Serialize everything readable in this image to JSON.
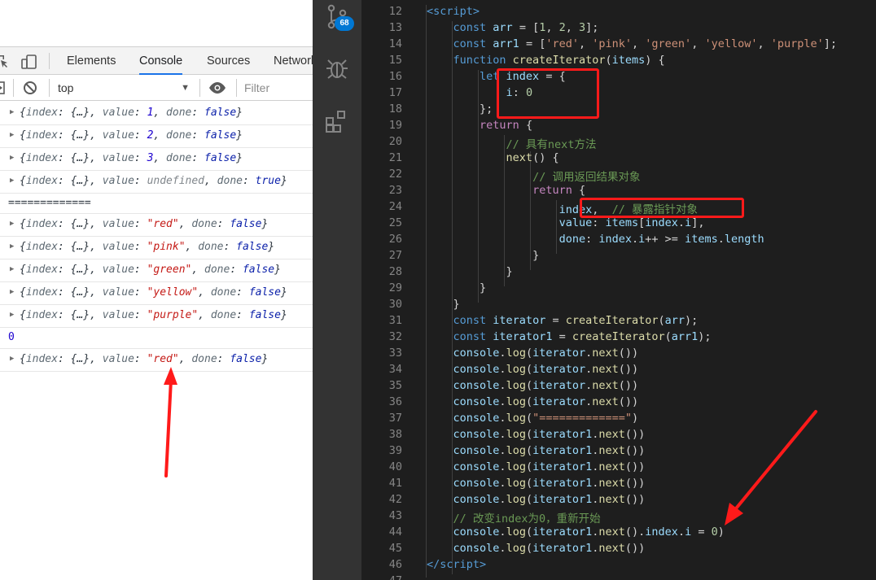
{
  "devtools": {
    "tabs": [
      "Elements",
      "Console",
      "Sources",
      "Network"
    ],
    "active_tab": "Console",
    "context": "top",
    "filter_placeholder": "Filter",
    "console_rows": [
      {
        "kind": "obj",
        "value": "1",
        "vtype": "num",
        "done": "false"
      },
      {
        "kind": "obj",
        "value": "2",
        "vtype": "num",
        "done": "false"
      },
      {
        "kind": "obj",
        "value": "3",
        "vtype": "num",
        "done": "false"
      },
      {
        "kind": "obj",
        "value": "undefined",
        "vtype": "undef",
        "done": "true"
      },
      {
        "kind": "plain",
        "text": "============="
      },
      {
        "kind": "obj",
        "value": "\"red\"",
        "vtype": "str",
        "done": "false"
      },
      {
        "kind": "obj",
        "value": "\"pink\"",
        "vtype": "str",
        "done": "false"
      },
      {
        "kind": "obj",
        "value": "\"green\"",
        "vtype": "str",
        "done": "false"
      },
      {
        "kind": "obj",
        "value": "\"yellow\"",
        "vtype": "str",
        "done": "false"
      },
      {
        "kind": "obj",
        "value": "\"purple\"",
        "vtype": "str",
        "done": "false"
      },
      {
        "kind": "num",
        "text": "0"
      },
      {
        "kind": "obj",
        "value": "\"red\"",
        "vtype": "str",
        "done": "false"
      }
    ]
  },
  "activity_bar": {
    "items": [
      "source-control-icon",
      "debug-icon",
      "extensions-icon"
    ],
    "scm_badge": "68"
  },
  "editor": {
    "lines": [
      {
        "n": "12",
        "t": [
          [
            "<",
            "tag"
          ],
          [
            "script",
            "tag"
          ],
          [
            ">",
            "tag"
          ]
        ]
      },
      {
        "n": "13",
        "t": [
          [
            "const ",
            "kw"
          ],
          [
            "arr",
            "var"
          ],
          [
            " = [",
            "p"
          ],
          [
            "1",
            "num"
          ],
          [
            ", ",
            "p"
          ],
          [
            "2",
            "num"
          ],
          [
            ", ",
            "p"
          ],
          [
            "3",
            "num"
          ],
          [
            "];",
            "p"
          ]
        ]
      },
      {
        "n": "14",
        "t": [
          [
            "const ",
            "kw"
          ],
          [
            "arr1",
            "var"
          ],
          [
            " = [",
            "p"
          ],
          [
            "'red'",
            "str"
          ],
          [
            ", ",
            "p"
          ],
          [
            "'pink'",
            "str"
          ],
          [
            ", ",
            "p"
          ],
          [
            "'green'",
            "str"
          ],
          [
            ", ",
            "p"
          ],
          [
            "'yellow'",
            "str"
          ],
          [
            ", ",
            "p"
          ],
          [
            "'purple'",
            "str"
          ],
          [
            "];",
            "p"
          ]
        ]
      },
      {
        "n": "15",
        "t": [
          [
            "function ",
            "kw"
          ],
          [
            "createIterator",
            "fn"
          ],
          [
            "(",
            "p"
          ],
          [
            "items",
            "var"
          ],
          [
            ") {",
            "p"
          ]
        ]
      },
      {
        "n": "16",
        "t": [
          [
            "let ",
            "kw"
          ],
          [
            "index",
            "var"
          ],
          [
            " = {",
            "p"
          ]
        ]
      },
      {
        "n": "17",
        "t": [
          [
            "i",
            "var"
          ],
          [
            ": ",
            "p"
          ],
          [
            "0",
            "num"
          ]
        ]
      },
      {
        "n": "18",
        "t": [
          [
            "};",
            "p"
          ]
        ]
      },
      {
        "n": "19",
        "t": [
          [
            "return",
            "ctl"
          ],
          [
            " {",
            "p"
          ]
        ]
      },
      {
        "n": "20",
        "t": [
          [
            "// 具有next方法",
            "cmt"
          ]
        ]
      },
      {
        "n": "21",
        "t": [
          [
            "next",
            "fn"
          ],
          [
            "() {",
            "p"
          ]
        ]
      },
      {
        "n": "22",
        "t": [
          [
            "// 调用返回结果对象",
            "cmt"
          ]
        ]
      },
      {
        "n": "23",
        "t": [
          [
            "return",
            "ctl"
          ],
          [
            " {",
            "p"
          ]
        ]
      },
      {
        "n": "24",
        "t": [
          [
            "index",
            "var"
          ],
          [
            ",  ",
            "p"
          ],
          [
            "// 暴露指针对象",
            "cmt"
          ]
        ]
      },
      {
        "n": "25",
        "t": [
          [
            "value",
            "var"
          ],
          [
            ": ",
            "p"
          ],
          [
            "items",
            "var"
          ],
          [
            "[",
            "p"
          ],
          [
            "index",
            "var"
          ],
          [
            ".",
            "p"
          ],
          [
            "i",
            "var"
          ],
          [
            "],",
            "p"
          ]
        ]
      },
      {
        "n": "26",
        "t": [
          [
            "done",
            "var"
          ],
          [
            ": ",
            "p"
          ],
          [
            "index",
            "var"
          ],
          [
            ".",
            "p"
          ],
          [
            "i",
            "var"
          ],
          [
            "++ >= ",
            "p"
          ],
          [
            "items",
            "var"
          ],
          [
            ".",
            "p"
          ],
          [
            "length",
            "var"
          ]
        ]
      },
      {
        "n": "27",
        "t": [
          [
            "}",
            "p"
          ]
        ]
      },
      {
        "n": "28",
        "t": [
          [
            "}",
            "p"
          ]
        ]
      },
      {
        "n": "29",
        "t": [
          [
            "}",
            "p"
          ]
        ]
      },
      {
        "n": "30",
        "t": [
          [
            "}",
            "p"
          ]
        ]
      },
      {
        "n": "31",
        "t": [
          [
            "const ",
            "kw"
          ],
          [
            "iterator",
            "var"
          ],
          [
            " = ",
            "p"
          ],
          [
            "createIterator",
            "fn"
          ],
          [
            "(",
            "p"
          ],
          [
            "arr",
            "var"
          ],
          [
            ");",
            "p"
          ]
        ]
      },
      {
        "n": "32",
        "t": [
          [
            "const ",
            "kw"
          ],
          [
            "iterator1",
            "var"
          ],
          [
            " = ",
            "p"
          ],
          [
            "createIterator",
            "fn"
          ],
          [
            "(",
            "p"
          ],
          [
            "arr1",
            "var"
          ],
          [
            ");",
            "p"
          ]
        ]
      },
      {
        "n": "33",
        "t": [
          [
            "console",
            "var"
          ],
          [
            ".",
            "p"
          ],
          [
            "log",
            "fn"
          ],
          [
            "(",
            "p"
          ],
          [
            "iterator",
            "var"
          ],
          [
            ".",
            "p"
          ],
          [
            "next",
            "fn"
          ],
          [
            "())",
            "p"
          ]
        ]
      },
      {
        "n": "34",
        "t": [
          [
            "console",
            "var"
          ],
          [
            ".",
            "p"
          ],
          [
            "log",
            "fn"
          ],
          [
            "(",
            "p"
          ],
          [
            "iterator",
            "var"
          ],
          [
            ".",
            "p"
          ],
          [
            "next",
            "fn"
          ],
          [
            "())",
            "p"
          ]
        ]
      },
      {
        "n": "35",
        "t": [
          [
            "console",
            "var"
          ],
          [
            ".",
            "p"
          ],
          [
            "log",
            "fn"
          ],
          [
            "(",
            "p"
          ],
          [
            "iterator",
            "var"
          ],
          [
            ".",
            "p"
          ],
          [
            "next",
            "fn"
          ],
          [
            "())",
            "p"
          ]
        ]
      },
      {
        "n": "36",
        "t": [
          [
            "console",
            "var"
          ],
          [
            ".",
            "p"
          ],
          [
            "log",
            "fn"
          ],
          [
            "(",
            "p"
          ],
          [
            "iterator",
            "var"
          ],
          [
            ".",
            "p"
          ],
          [
            "next",
            "fn"
          ],
          [
            "())",
            "p"
          ]
        ]
      },
      {
        "n": "37",
        "t": [
          [
            "console",
            "var"
          ],
          [
            ".",
            "p"
          ],
          [
            "log",
            "fn"
          ],
          [
            "(",
            "p"
          ],
          [
            "\"=============\"",
            "str"
          ],
          [
            ")",
            "p"
          ]
        ]
      },
      {
        "n": "38",
        "t": [
          [
            "console",
            "var"
          ],
          [
            ".",
            "p"
          ],
          [
            "log",
            "fn"
          ],
          [
            "(",
            "p"
          ],
          [
            "iterator1",
            "var"
          ],
          [
            ".",
            "p"
          ],
          [
            "next",
            "fn"
          ],
          [
            "())",
            "p"
          ]
        ]
      },
      {
        "n": "39",
        "t": [
          [
            "console",
            "var"
          ],
          [
            ".",
            "p"
          ],
          [
            "log",
            "fn"
          ],
          [
            "(",
            "p"
          ],
          [
            "iterator1",
            "var"
          ],
          [
            ".",
            "p"
          ],
          [
            "next",
            "fn"
          ],
          [
            "())",
            "p"
          ]
        ]
      },
      {
        "n": "40",
        "t": [
          [
            "console",
            "var"
          ],
          [
            ".",
            "p"
          ],
          [
            "log",
            "fn"
          ],
          [
            "(",
            "p"
          ],
          [
            "iterator1",
            "var"
          ],
          [
            ".",
            "p"
          ],
          [
            "next",
            "fn"
          ],
          [
            "())",
            "p"
          ]
        ]
      },
      {
        "n": "41",
        "t": [
          [
            "console",
            "var"
          ],
          [
            ".",
            "p"
          ],
          [
            "log",
            "fn"
          ],
          [
            "(",
            "p"
          ],
          [
            "iterator1",
            "var"
          ],
          [
            ".",
            "p"
          ],
          [
            "next",
            "fn"
          ],
          [
            "())",
            "p"
          ]
        ]
      },
      {
        "n": "42",
        "t": [
          [
            "console",
            "var"
          ],
          [
            ".",
            "p"
          ],
          [
            "log",
            "fn"
          ],
          [
            "(",
            "p"
          ],
          [
            "iterator1",
            "var"
          ],
          [
            ".",
            "p"
          ],
          [
            "next",
            "fn"
          ],
          [
            "())",
            "p"
          ]
        ]
      },
      {
        "n": "43",
        "t": [
          [
            "// 改变index为0，重新开始",
            "cmt"
          ]
        ]
      },
      {
        "n": "44",
        "t": [
          [
            "console",
            "var"
          ],
          [
            ".",
            "p"
          ],
          [
            "log",
            "fn"
          ],
          [
            "(",
            "p"
          ],
          [
            "iterator1",
            "var"
          ],
          [
            ".",
            "p"
          ],
          [
            "next",
            "fn"
          ],
          [
            "().",
            "p"
          ],
          [
            "index",
            "var"
          ],
          [
            ".",
            "p"
          ],
          [
            "i",
            "var"
          ],
          [
            " = ",
            "p"
          ],
          [
            "0",
            "num"
          ],
          [
            ")",
            "p"
          ]
        ]
      },
      {
        "n": "45",
        "t": [
          [
            "console",
            "var"
          ],
          [
            ".",
            "p"
          ],
          [
            "log",
            "fn"
          ],
          [
            "(",
            "p"
          ],
          [
            "iterator1",
            "var"
          ],
          [
            ".",
            "p"
          ],
          [
            "next",
            "fn"
          ],
          [
            "())",
            "p"
          ]
        ]
      },
      {
        "n": "46",
        "t": [
          [
            "</",
            "tag"
          ],
          [
            "script",
            "tag"
          ],
          [
            ">",
            "tag"
          ]
        ]
      },
      {
        "n": "47",
        "t": []
      }
    ]
  }
}
